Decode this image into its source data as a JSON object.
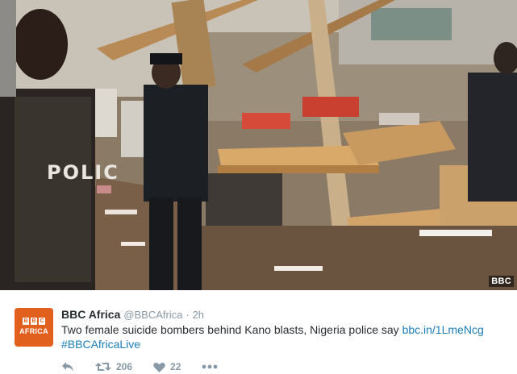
{
  "media": {
    "police_vest_text": "POLIC",
    "watermark": "BBC"
  },
  "tweet": {
    "avatar": {
      "logo_letters": [
        "B",
        "B",
        "C"
      ],
      "logo_word": "AFRICA"
    },
    "display_name": "BBC Africa",
    "handle": "@BBCAfrica",
    "separator": "·",
    "time": "2h",
    "text": "Two female suicide bombers behind Kano blasts, Nigeria police say",
    "link": "bbc.in/1LmeNcg",
    "hashtag": "#BBCAfricaLive",
    "actions": {
      "reply_icon": "reply-icon",
      "retweet_icon": "retweet-icon",
      "retweet_count": "206",
      "like_icon": "heart-icon",
      "like_count": "22",
      "more_icon": "more-icon"
    }
  },
  "colors": {
    "brand_orange": "#e2601e",
    "link_blue": "#1a7eb8",
    "text_dark": "#292f33",
    "text_muted": "#8899a6"
  }
}
